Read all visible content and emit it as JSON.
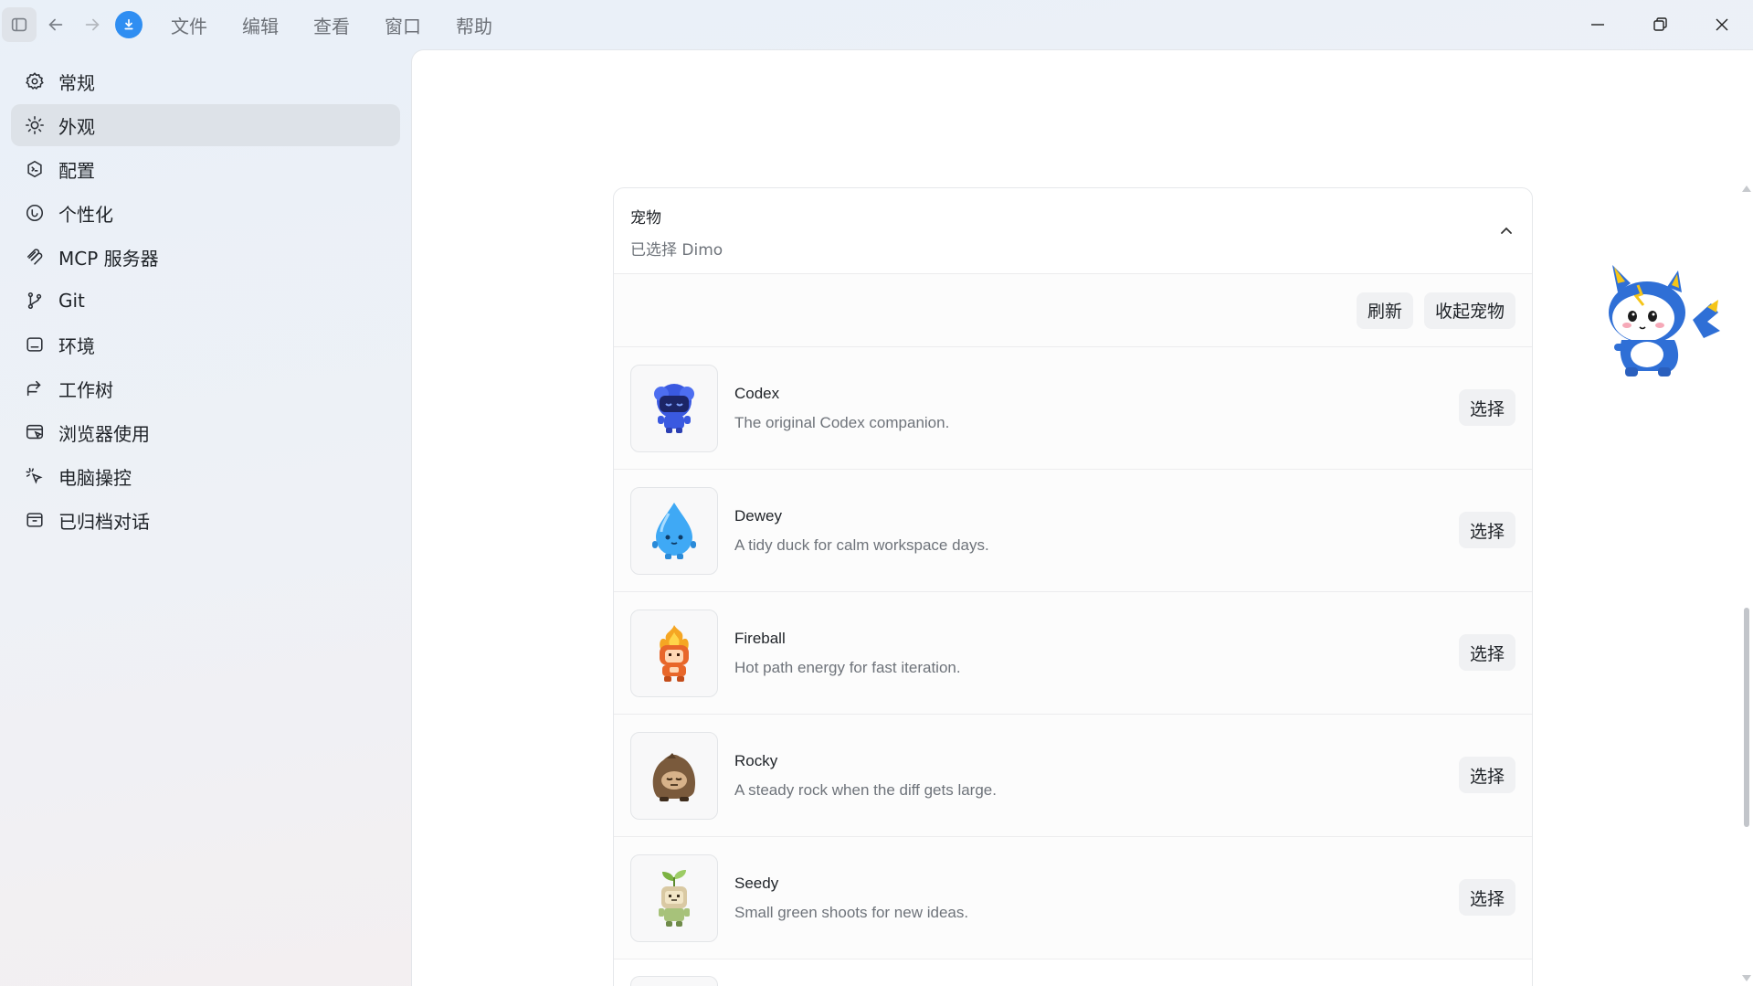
{
  "titlebar": {
    "menu": [
      "文件",
      "编辑",
      "查看",
      "窗口",
      "帮助"
    ],
    "accent": "#2f8ef2"
  },
  "sidebar": {
    "items": [
      {
        "label": "常规",
        "icon": "gear-icon",
        "active": false
      },
      {
        "label": "外观",
        "icon": "sun-icon",
        "active": true
      },
      {
        "label": "配置",
        "icon": "config-icon",
        "active": false
      },
      {
        "label": "个性化",
        "icon": "personalize-icon",
        "active": false
      },
      {
        "label": "MCP 服务器",
        "icon": "mcp-icon",
        "active": false
      },
      {
        "label": "Git",
        "icon": "git-branch-icon",
        "active": false
      },
      {
        "label": "环境",
        "icon": "terminal-icon",
        "active": false
      },
      {
        "label": "工作树",
        "icon": "worktree-icon",
        "active": false
      },
      {
        "label": "浏览器使用",
        "icon": "browser-icon",
        "active": false
      },
      {
        "label": "电脑操控",
        "icon": "pointer-icon",
        "active": false
      },
      {
        "label": "已归档对话",
        "icon": "archive-icon",
        "active": false
      }
    ]
  },
  "pets": {
    "title": "宠物",
    "selected_text": "已选择 Dimo",
    "refresh_label": "刷新",
    "collapse_label": "收起宠物",
    "select_label": "选择",
    "items": [
      {
        "name": "Codex",
        "desc": "The original Codex companion.",
        "icon": "codex-pet-icon"
      },
      {
        "name": "Dewey",
        "desc": "A tidy duck for calm workspace days.",
        "icon": "dewey-pet-icon"
      },
      {
        "name": "Fireball",
        "desc": "Hot path energy for fast iteration.",
        "icon": "fireball-pet-icon"
      },
      {
        "name": "Rocky",
        "desc": "A steady rock when the diff gets large.",
        "icon": "rocky-pet-icon"
      },
      {
        "name": "Seedy",
        "desc": "Small green shoots for new ideas.",
        "icon": "seedy-pet-icon"
      }
    ]
  },
  "mascot": {
    "name": "Dimo",
    "icon": "dimo-mascot-icon"
  }
}
